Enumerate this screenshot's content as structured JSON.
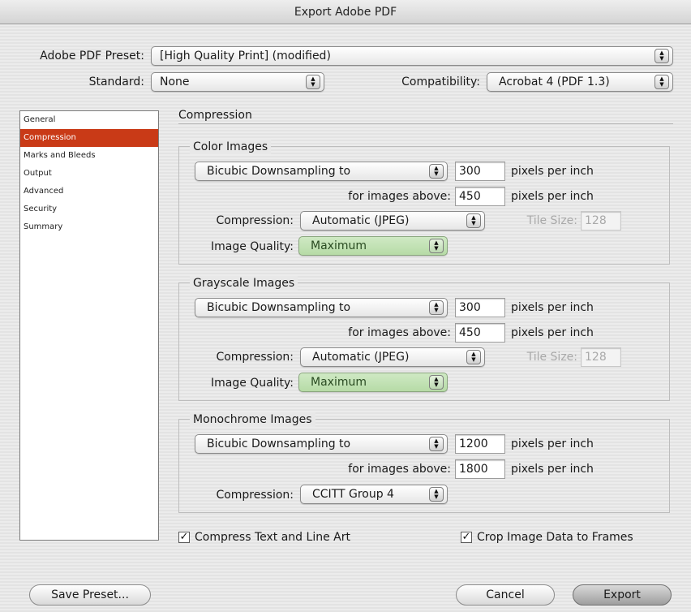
{
  "window": {
    "title": "Export Adobe PDF"
  },
  "preset": {
    "label": "Adobe PDF Preset:",
    "value": "[High Quality Print] (modified)"
  },
  "standard": {
    "label": "Standard:",
    "value": "None"
  },
  "compatibility": {
    "label": "Compatibility:",
    "value": "Acrobat 4 (PDF 1.3)"
  },
  "sidebar": {
    "items": [
      {
        "label": "General"
      },
      {
        "label": "Compression"
      },
      {
        "label": "Marks and Bleeds"
      },
      {
        "label": "Output"
      },
      {
        "label": "Advanced"
      },
      {
        "label": "Security"
      },
      {
        "label": "Summary"
      }
    ],
    "selected": "Compression"
  },
  "section": {
    "title": "Compression"
  },
  "color": {
    "title": "Color Images",
    "downsample": "Bicubic Downsampling to",
    "ppi": "300",
    "ppi_unit": "pixels per inch",
    "above_label": "for images above:",
    "above": "450",
    "above_unit": "pixels per inch",
    "compression_label": "Compression:",
    "compression": "Automatic (JPEG)",
    "tile_label": "Tile Size:",
    "tile": "128",
    "quality_label": "Image Quality:",
    "quality": "Maximum"
  },
  "grayscale": {
    "title": "Grayscale Images",
    "downsample": "Bicubic Downsampling to",
    "ppi": "300",
    "ppi_unit": "pixels per inch",
    "above_label": "for images above:",
    "above": "450",
    "above_unit": "pixels per inch",
    "compression_label": "Compression:",
    "compression": "Automatic (JPEG)",
    "tile_label": "Tile Size:",
    "tile": "128",
    "quality_label": "Image Quality:",
    "quality": "Maximum"
  },
  "monochrome": {
    "title": "Monochrome Images",
    "downsample": "Bicubic Downsampling to",
    "ppi": "1200",
    "ppi_unit": "pixels per inch",
    "above_label": "for images above:",
    "above": "1800",
    "above_unit": "pixels per inch",
    "compression_label": "Compression:",
    "compression": "CCITT Group 4"
  },
  "options": {
    "compress_text": {
      "label": "Compress Text and Line Art",
      "checked": true
    },
    "crop_image": {
      "label": "Crop Image Data to Frames",
      "checked": true
    }
  },
  "buttons": {
    "save_preset": "Save Preset...",
    "cancel": "Cancel",
    "export": "Export"
  },
  "glyphs": {
    "check": "✓",
    "updown": "▲▼"
  }
}
